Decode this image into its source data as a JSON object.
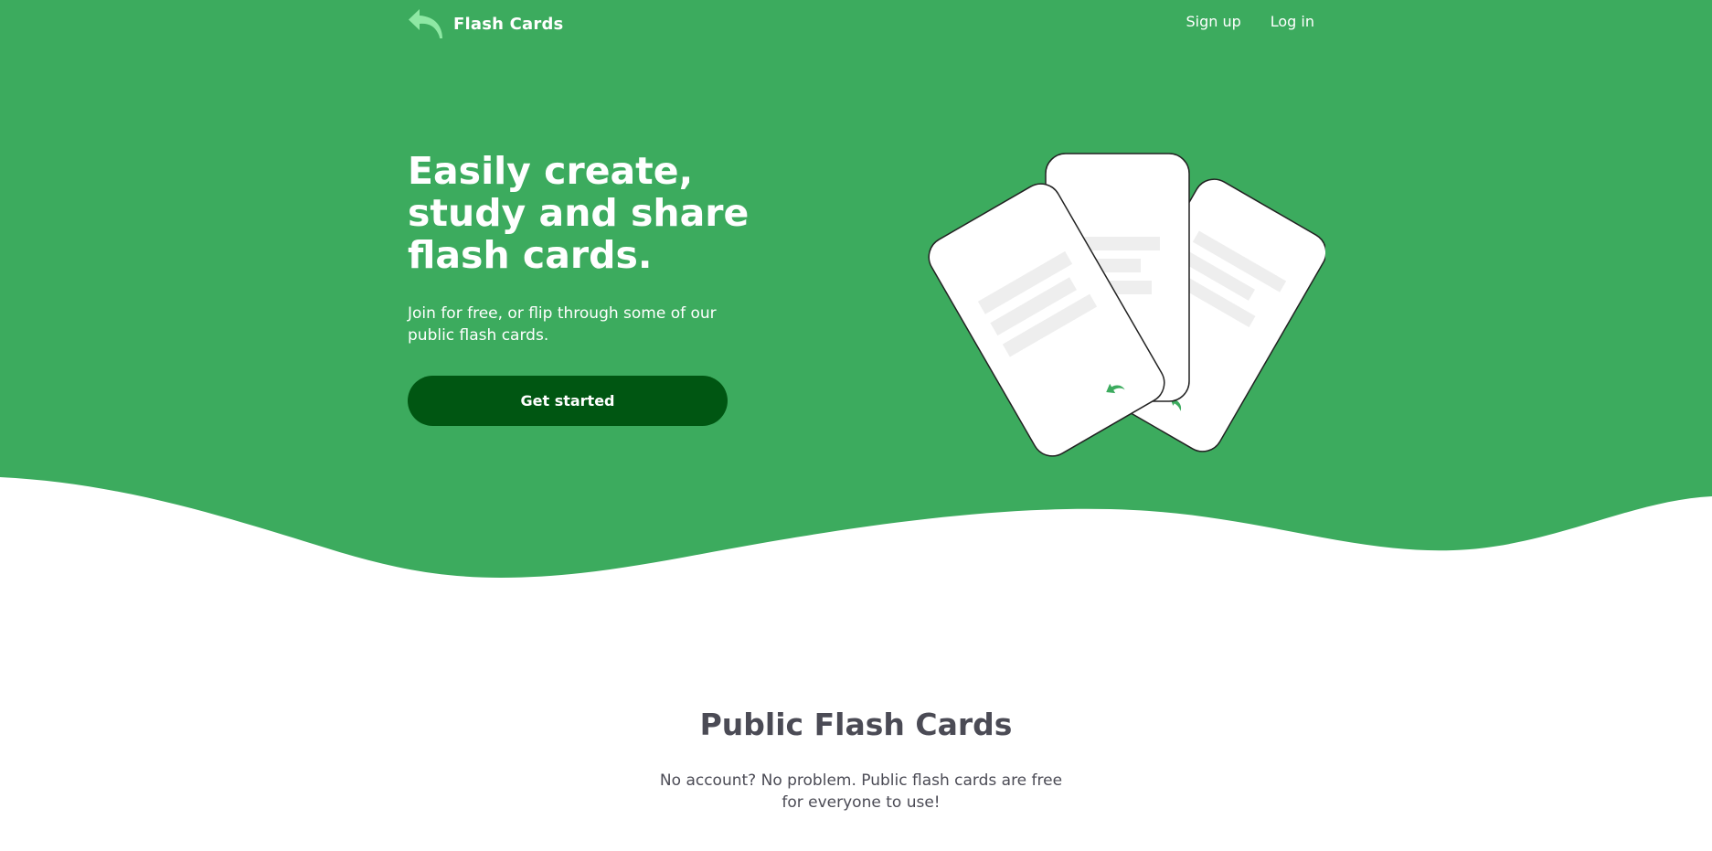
{
  "colors": {
    "brand_green": "#3cab5e",
    "dark_green": "#005612",
    "logo_green": "#8ee8a4",
    "text_dark": "#4b4b55",
    "white": "#ffffff"
  },
  "header": {
    "logo_icon": "back-arrow-icon",
    "brand_name": "Flash Cards",
    "nav": {
      "signup_label": "Sign up",
      "login_label": "Log in"
    }
  },
  "hero": {
    "headline": "Easily create, study and share flash cards.",
    "subheadline": "Join for free, or flip through some of our public flash cards.",
    "cta_label": "Get started",
    "illustration_icon": "flash-cards-illustration"
  },
  "public_section": {
    "title": "Public Flash Cards",
    "description": "No account? No problem. Public flash cards are free for everyone to use!"
  }
}
